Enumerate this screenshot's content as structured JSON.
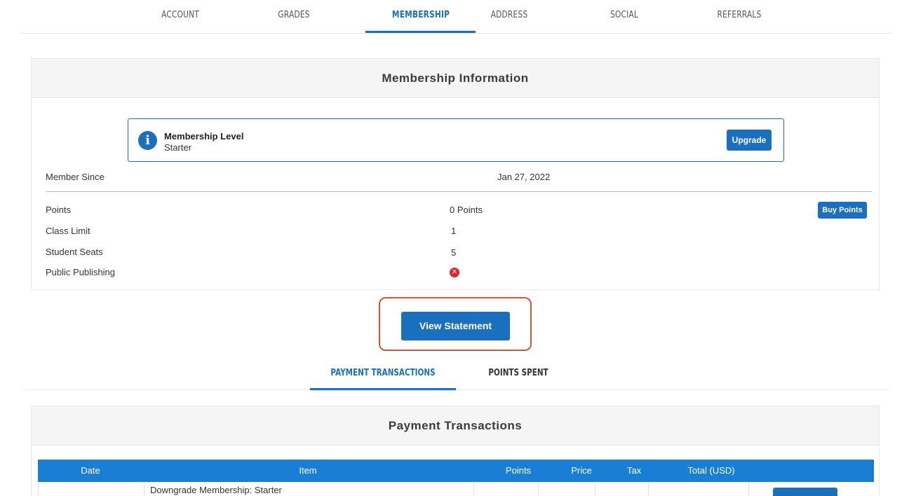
{
  "top_tabs": [
    "ACCOUNT",
    "GRADES",
    "MEMBERSHIP",
    "ADDRESS",
    "SOCIAL",
    "REFERRALS"
  ],
  "top_tab_active": "MEMBERSHIP",
  "membership_card": {
    "title": "Membership Information",
    "level_label": "Membership Level",
    "level_value": "Starter",
    "upgrade_label": "Upgrade",
    "member_since_label": "Member Since",
    "member_since_value": "Jan 27, 2022",
    "points_label": "Points",
    "points_value": "0 Points",
    "buy_points_label": "Buy Points",
    "class_limit_label": "Class Limit",
    "class_limit_value": "1",
    "student_seats_label": "Student Seats",
    "student_seats_value": "5",
    "public_publishing_label": "Public Publishing",
    "public_publishing_status": "disabled"
  },
  "view_statement_label": "View Statement",
  "sub_tabs": [
    "PAYMENT TRANSACTIONS",
    "POINTS SPENT"
  ],
  "sub_tab_active": "PAYMENT TRANSACTIONS",
  "payment_card": {
    "title": "Payment Transactions",
    "columns": [
      "Date",
      "Item",
      "Points",
      "Price",
      "Tax",
      "Total (USD)"
    ],
    "rows": [
      {
        "item": "Downgrade Membership: Starter"
      }
    ]
  },
  "colors": {
    "accent": "#1a6fbf",
    "table_header": "#1a7fd4",
    "highlight": "#d2553f",
    "error": "#e0262a"
  }
}
